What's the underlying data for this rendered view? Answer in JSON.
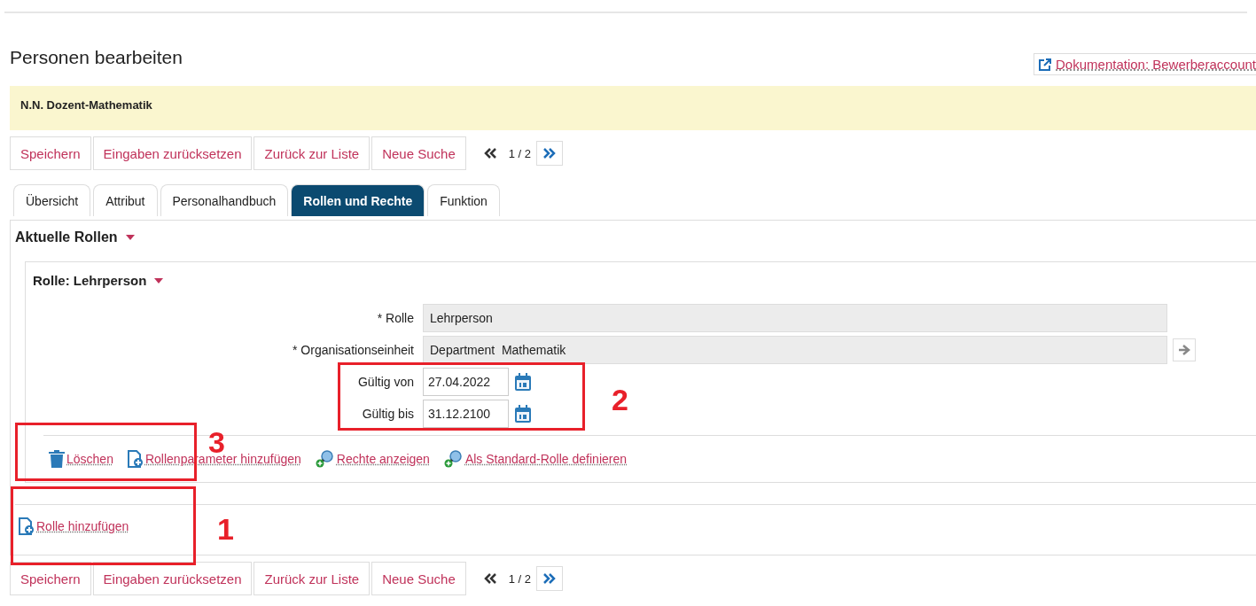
{
  "header": {
    "title": "Personen bearbeiten",
    "doc_link": "Dokumentation: Bewerberaccount"
  },
  "banner": "N.N. Dozent-Mathematik",
  "toolbars": [
    {
      "buttons": [
        "Speichern",
        "Eingaben zurücksetzen",
        "Zurück zur Liste",
        "Neue Suche"
      ],
      "pager": "1 / 2"
    },
    {
      "buttons": [
        "Speichern",
        "Eingaben zurücksetzen",
        "Zurück zur Liste",
        "Neue Suche"
      ],
      "pager": "1 / 2"
    }
  ],
  "tabs": [
    {
      "label": "Übersicht",
      "selected": false
    },
    {
      "label": "Attribut",
      "selected": false
    },
    {
      "label": "Personalhandbuch",
      "selected": false
    },
    {
      "label": "Rollen und Rechte",
      "selected": true
    },
    {
      "label": "Funktion",
      "selected": false
    }
  ],
  "section": {
    "title": "Aktuelle Rollen",
    "expanded": true,
    "role": {
      "title": "Rolle: Lehrperson",
      "expanded": true,
      "fields": [
        {
          "label": "* Rolle",
          "value": "Lehrperson",
          "kind": "readonly"
        },
        {
          "label": "* Organisationseinheit",
          "value": "Department  Mathematik",
          "kind": "readonly-link"
        },
        {
          "label": "Gültig von",
          "value": "27.04.2022",
          "kind": "date"
        },
        {
          "label": "Gültig bis",
          "value": "31.12.2100",
          "kind": "date"
        }
      ],
      "actions": [
        {
          "label": "Löschen",
          "kind": "trash"
        },
        {
          "label": "Rollenparameter hinzufügen",
          "kind": "add-doc"
        },
        {
          "label": "Rechte anzeigen",
          "kind": "search-add"
        },
        {
          "label": "Als Standard-Rolle definieren",
          "kind": "search-add"
        }
      ]
    }
  },
  "add_link": "Rolle hinzufügen",
  "annotations": [
    {
      "label": "1"
    },
    {
      "label": "2"
    },
    {
      "label": "3"
    }
  ]
}
